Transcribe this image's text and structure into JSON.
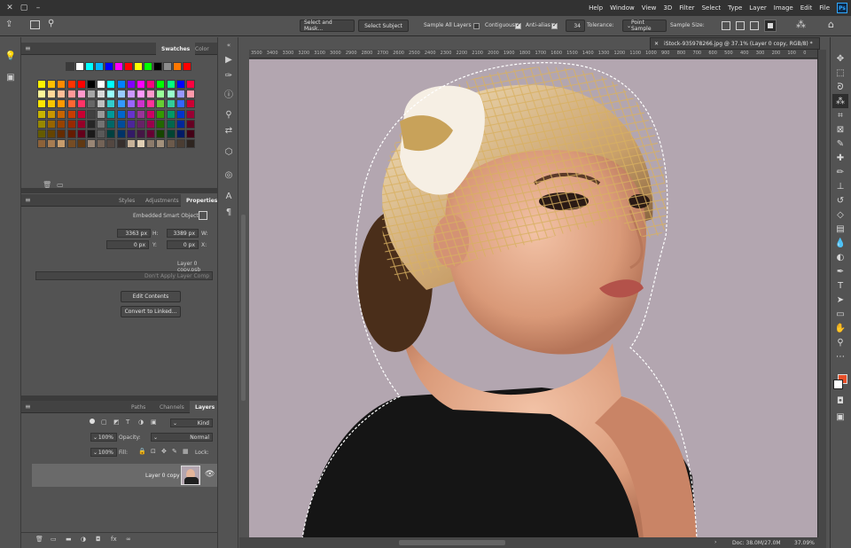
{
  "menu": {
    "items": [
      "Help",
      "Window",
      "View",
      "3D",
      "Filter",
      "Select",
      "Type",
      "Layer",
      "Image",
      "Edit",
      "File"
    ]
  },
  "options_bar": {
    "select_and_mask": "Select and Mask...",
    "select_subject": "Select Subject",
    "sample_all_layers": "Sample All Layers",
    "contiguous": "Contiguous",
    "anti_alias": "Anti-alias",
    "tolerance_label": "Tolerance:",
    "tolerance_value": "34",
    "sample_size_label": "Sample Size:",
    "sample_size_value": "Point Sample"
  },
  "document": {
    "tab_title": "iStock-935978266.jpg @ 37.1% (Layer 0 copy, RGB/8) *",
    "status_left": "Doc: 38.0M/27.0M",
    "status_right": "37.09%",
    "ruler_marks": [
      "3500",
      "3400",
      "3300",
      "3200",
      "3100",
      "3000",
      "2900",
      "2800",
      "2700",
      "2600",
      "2500",
      "2400",
      "2300",
      "2200",
      "2100",
      "2000",
      "1900",
      "1800",
      "1700",
      "1600",
      "1500",
      "1400",
      "1300",
      "1200",
      "1100",
      "1000",
      "900",
      "800",
      "700",
      "600",
      "500",
      "400",
      "300",
      "200",
      "100",
      "0"
    ]
  },
  "swatches_panel": {
    "tabs": [
      "Swatches",
      "Color"
    ],
    "colors_top": [
      "#3a3a3a",
      "#ffffff",
      "#00ffff",
      "#00b7ff",
      "#0000ff",
      "#ff00ff",
      "#ff0000",
      "#ffff00",
      "#00ff00",
      "#000000",
      "#8c8c8c",
      "#ff7700",
      "#ff0000"
    ],
    "grid": [
      [
        "#fff200",
        "#ffbf00",
        "#ff8a00",
        "#ff3300",
        "#ff0000",
        "#000000",
        "#ffffff",
        "#00ffff",
        "#0080ff",
        "#8000ff",
        "#ff00ff",
        "#ff0080",
        "#00ff00",
        "#00ff80",
        "#0000ff",
        "#ff0040"
      ],
      [
        "#fff799",
        "#ffd799",
        "#ffbe99",
        "#ff9999",
        "#ff99cc",
        "#a6a6a6",
        "#d9d9d9",
        "#99ffff",
        "#99ccff",
        "#cc99ff",
        "#ff99ff",
        "#ff99cc",
        "#99ff99",
        "#99ffcc",
        "#9999ff",
        "#ff99aa"
      ],
      [
        "#ffe600",
        "#f7c600",
        "#ff9900",
        "#ff6633",
        "#ff3366",
        "#666666",
        "#bfbfbf",
        "#33cccc",
        "#3399ff",
        "#9966ff",
        "#cc33cc",
        "#ff3399",
        "#66cc33",
        "#33cc99",
        "#3366ff",
        "#cc0033"
      ],
      [
        "#c8b400",
        "#c89600",
        "#c86400",
        "#c83c00",
        "#c80032",
        "#404040",
        "#999999",
        "#009999",
        "#0066cc",
        "#6633cc",
        "#993399",
        "#cc0066",
        "#339900",
        "#009966",
        "#0033cc",
        "#990033"
      ],
      [
        "#968700",
        "#966400",
        "#964100",
        "#962800",
        "#960028",
        "#262626",
        "#737373",
        "#006666",
        "#004c99",
        "#4c2699",
        "#662266",
        "#99004c",
        "#226600",
        "#00664c",
        "#002699",
        "#660022"
      ],
      [
        "#645a00",
        "#644300",
        "#642b00",
        "#641b00",
        "#64001b",
        "#1a1a1a",
        "#595959",
        "#004040",
        "#003366",
        "#331a66",
        "#441644",
        "#660033",
        "#164400",
        "#004433",
        "#001a66",
        "#440016"
      ],
      [
        "#8c6239",
        "#a67c52",
        "#c69c6d",
        "#754c24",
        "#603913",
        "#998675",
        "#736357",
        "#534741",
        "#362f2d",
        "#c7b299",
        "#e0cfb4",
        "#8c7b6b",
        "#a3917c",
        "#6b5a4b",
        "#4a3d33",
        "#2e2520"
      ]
    ]
  },
  "properties_panel": {
    "tabs": [
      "Properties",
      "Adjustments",
      "Styles"
    ],
    "object_type": "Embedded Smart Object",
    "w_label": "W:",
    "w_value": "3389 px",
    "h_label": "H:",
    "h_value": "3363 px",
    "x_label": "X:",
    "x_value": "0 px",
    "y_label": "Y:",
    "y_value": "0 px",
    "source_name": "Layer 0 copy.psb",
    "layer_comp_placeholder": "Don't Apply Layer Comp",
    "edit_contents": "Edit Contents",
    "convert_linked": "Convert to Linked..."
  },
  "layers_panel": {
    "tabs": [
      "Layers",
      "Channels",
      "Paths"
    ],
    "kind_label": "Kind",
    "blend_mode": "Normal",
    "opacity_label": "Opacity:",
    "opacity_value": "100%",
    "lock_label": "Lock:",
    "fill_label": "Fill:",
    "fill_value": "100%",
    "layer_name": "Layer 0 copy"
  },
  "colors": {
    "foreground": "#e8502a",
    "background": "#ffffff",
    "canvas_bg": "#b3a6b0",
    "panel_bg": "#535353",
    "menubar_bg": "#323232"
  }
}
